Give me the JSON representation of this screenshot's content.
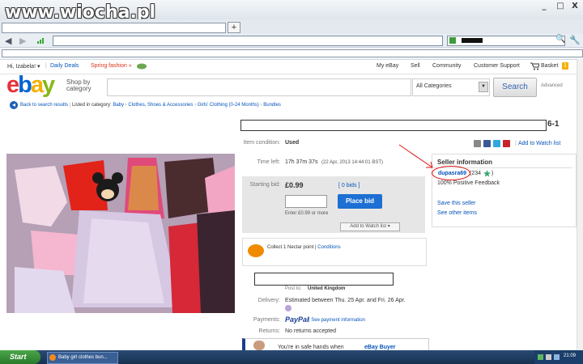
{
  "watermark": "www.wiocha.pl",
  "browser": {
    "window_buttons": [
      "_",
      "□",
      "X"
    ],
    "new_tab": "+",
    "search_mag": "🔍",
    "tools": "🔧"
  },
  "ebay": {
    "top_nav": {
      "greeting": "Hi, Izabela! ▾",
      "daily_deals": "Daily Deals",
      "spring_fashion": "Spring fashion »",
      "my_ebay": "My eBay",
      "sell": "Sell",
      "community": "Community",
      "customer_support": "Customer Support",
      "basket": "Basket",
      "basket_count": "1"
    },
    "logo_letters": [
      "e",
      "b",
      "a",
      "y"
    ],
    "shop_by_category": "Shop by category",
    "category_select": "All Categories",
    "search_button": "Search",
    "advanced": "Advanced",
    "breadcrumb": {
      "back": "Back to search results",
      "listed_in": "Listed in category:",
      "items": [
        "Baby",
        "Clothes, Shoes & Accessories",
        "Girls' Clothing (0-24 Months)",
        "Bundles"
      ]
    }
  },
  "item": {
    "title_suffix": "6-1",
    "condition_label": "Item condition:",
    "condition_value": "Used",
    "time_left_label": "Time left:",
    "time_left_value": "17h 37m 37s",
    "time_left_date": "(22 Apr, 2013 14:44:01 BST)",
    "starting_bid_label": "Starting bid:",
    "starting_bid_value": "£0.99",
    "bids": "[ 0 bids ]",
    "place_bid": "Place bid",
    "bid_hint": "Enter £0.99 or more",
    "add_watch": "Add to Watch list",
    "add_watch_link": "Add to Watch list",
    "nectar_text": "Collect 1 Nectar point",
    "conditions": "Conditions",
    "post_to_label": "Post to:",
    "post_to_value": "United Kingdom",
    "delivery_label": "Delivery:",
    "delivery_value": "Estimated between Thu. 25 Apr. and Fri. 26 Apr.",
    "payments_label": "Payments:",
    "paypal": "PayPal",
    "payment_info": "See payment information",
    "returns_label": "Returns:",
    "returns_value": "No returns accepted",
    "safe_hands": "You're in safe hands when",
    "ebay_buyer": "eBay Buyer"
  },
  "seller": {
    "title": "Seller information",
    "name": "dupasra69",
    "score": "(234",
    "score_close": ")",
    "feedback": "100% Positive Feedback",
    "save_seller": "Save this seller",
    "other_items": "See other items"
  },
  "taskbar": {
    "start": "Start",
    "task_item": "Baby girl clothes bun...",
    "clock": "21:09"
  }
}
